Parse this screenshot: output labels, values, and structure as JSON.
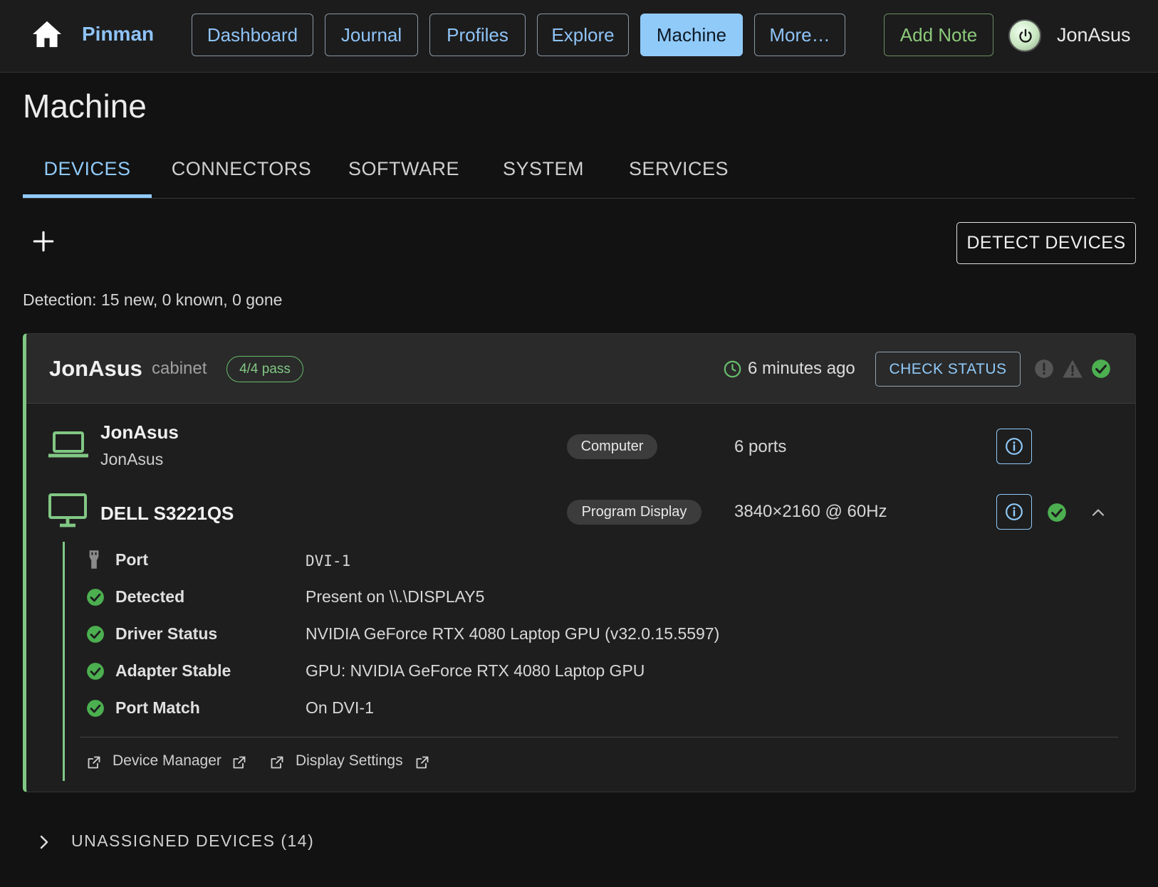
{
  "app": {
    "name": "Pinman"
  },
  "nav": {
    "items": [
      {
        "label": "Dashboard",
        "active": false
      },
      {
        "label": "Journal",
        "active": false
      },
      {
        "label": "Profiles",
        "active": false
      },
      {
        "label": "Explore",
        "active": false
      },
      {
        "label": "Machine",
        "active": true
      },
      {
        "label": "More…",
        "active": false
      }
    ],
    "add_note_label": "Add Note",
    "user": "JonAsus"
  },
  "page": {
    "title": "Machine"
  },
  "tabs": [
    {
      "label": "DEVICES",
      "active": true
    },
    {
      "label": "CONNECTORS",
      "active": false
    },
    {
      "label": "SOFTWARE",
      "active": false
    },
    {
      "label": "SYSTEM",
      "active": false
    },
    {
      "label": "SERVICES",
      "active": false
    }
  ],
  "toolbar": {
    "add_icon": "plus-icon",
    "detect_label": "DETECT DEVICES",
    "detection_summary": "Detection: 15 new, 0 known, 0 gone"
  },
  "cabinet": {
    "name": "JonAsus",
    "location": "cabinet",
    "pass_badge": "4/4 pass",
    "last_check": "6 minutes ago",
    "check_label": "CHECK STATUS",
    "accent_color": "#81c784",
    "devices": [
      {
        "name": "JonAsus",
        "subtitle": "JonAsus",
        "role": "Computer",
        "meta": "6 ports",
        "icon": "laptop-icon"
      },
      {
        "name": "DELL S3221QS",
        "role": "Program Display",
        "meta": "3840×2160 @ 60Hz",
        "icon": "monitor-icon",
        "details": [
          {
            "label": "Port",
            "value": "DVI-1",
            "icon": "plug-icon"
          },
          {
            "label": "Detected",
            "value": "Present on \\\\.\\DISPLAY5",
            "icon": "check-circle-icon"
          },
          {
            "label": "Driver Status",
            "value": "NVIDIA GeForce RTX 4080 Laptop GPU (v32.0.15.5597)",
            "icon": "check-circle-icon"
          },
          {
            "label": "Adapter Stable",
            "value": "GPU: NVIDIA GeForce RTX 4080 Laptop GPU",
            "icon": "check-circle-icon"
          },
          {
            "label": "Port Match",
            "value": "On DVI-1",
            "icon": "check-circle-icon"
          }
        ],
        "links": [
          {
            "label": "Device Manager"
          },
          {
            "label": "Display Settings"
          }
        ]
      }
    ]
  },
  "unassigned": {
    "label": "UNASSIGNED DEVICES (14)"
  }
}
